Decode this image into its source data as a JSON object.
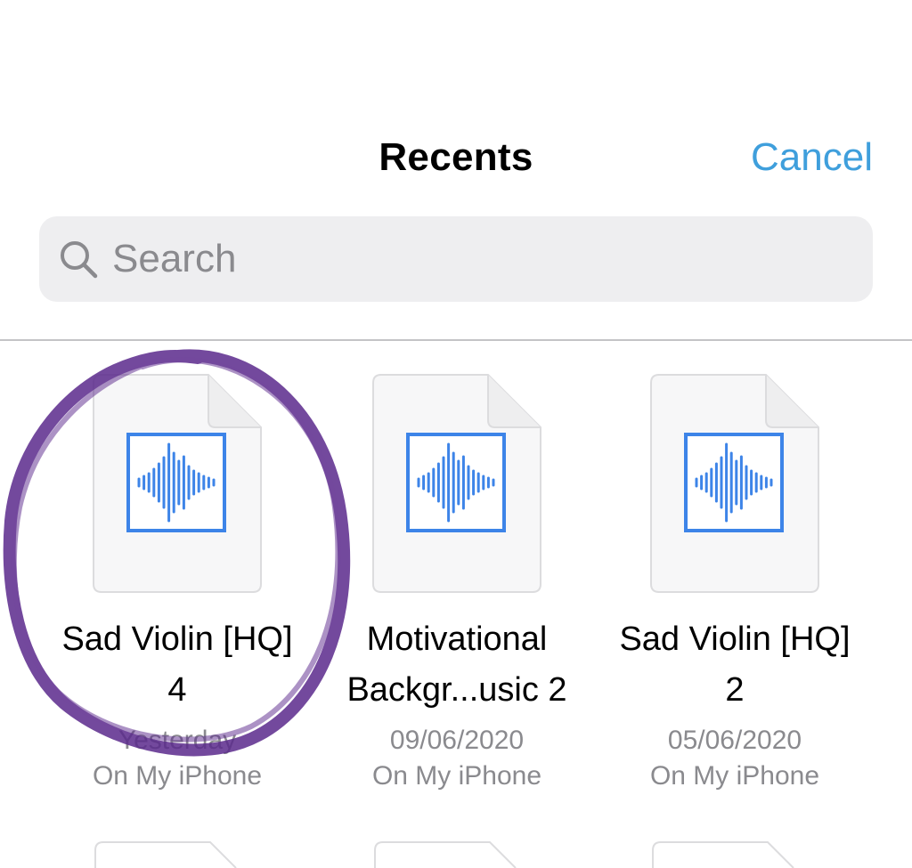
{
  "header": {
    "title": "Recents",
    "cancel_label": "Cancel",
    "accent_color": "#3f9fdc"
  },
  "search": {
    "placeholder": "Search",
    "icon": "search-icon"
  },
  "files": [
    {
      "name_line1": "Sad Violin [HQ]",
      "name_line2": "4",
      "date": "Yesterday",
      "location": "On My iPhone",
      "icon": "audio-waveform-icon"
    },
    {
      "name_line1": "Motivational",
      "name_line2": "Backgr...usic 2",
      "date": "09/06/2020",
      "location": "On My iPhone",
      "icon": "audio-waveform-icon"
    },
    {
      "name_line1": "Sad Violin [HQ]",
      "name_line2": "2",
      "date": "05/06/2020",
      "location": "On My iPhone",
      "icon": "audio-waveform-icon"
    }
  ],
  "annotation": {
    "shape": "hand-drawn circle",
    "color": "#5b2a8c",
    "highlights_file_index": 0
  }
}
